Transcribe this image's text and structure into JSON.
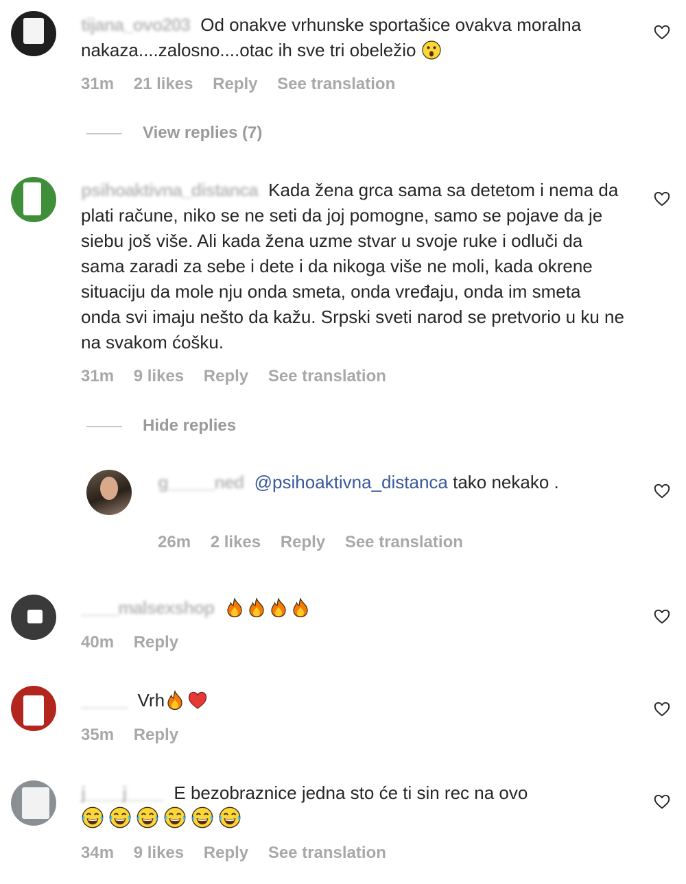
{
  "colors": {
    "text": "#262626",
    "meta": "#a8a8a8",
    "mention": "#385898",
    "heart_outline": "#262626"
  },
  "comments": [
    {
      "username": "tijana_ovo203",
      "text": "Od onakve vrhunske sportašice ovakva moralna nakaza....zalosno....otac ih sve tri obeležio",
      "emoji": "astonished-face",
      "time": "31m",
      "likes": "21 likes",
      "reply": "Reply",
      "see_translation": "See translation",
      "replies_toggle": "View replies (7)"
    },
    {
      "username": "psihoaktivna_distanca",
      "text": "Kada žena grca sama sa detetom i nema da plati račune, niko se ne seti da joj pomogne, samo se pojave da je siebu još više. Ali kada žena uzme stvar u svoje ruke i odluči da sama zaradi za sebe i dete i da nikoga više ne moli, kada okrene situaciju da mole nju onda smeta, onda vređaju, onda im smeta onda svi imaju nešto da kažu. Srpski sveti narod se pretvorio u ku ne na svakom ćošku.",
      "time": "31m",
      "likes": "9 likes",
      "reply": "Reply",
      "see_translation": "See translation",
      "replies_toggle": "Hide replies"
    },
    {
      "username": "g_____ned",
      "mention": "@psihoaktivna_distanca",
      "text": "tako nekako .",
      "time": "26m",
      "likes": "2 likes",
      "reply": "Reply",
      "see_translation": "See translation"
    },
    {
      "username": "____malsexshop",
      "emoji": "fire x4",
      "time": "40m",
      "reply": "Reply"
    },
    {
      "username": "_____",
      "text": "Vrh",
      "emoji": "fire, red-heart",
      "time": "35m",
      "reply": "Reply"
    },
    {
      "username": "j____j____",
      "text": "E bezobraznice jedna sto će ti sin rec na ovo",
      "emoji": "tears-of-joy x6",
      "time": "34m",
      "likes": "9 likes",
      "reply": "Reply",
      "see_translation": "See translation"
    }
  ]
}
